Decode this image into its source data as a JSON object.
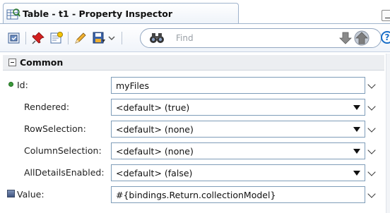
{
  "window": {
    "title": "Table - t1 - Property Inspector"
  },
  "toolbar": {
    "search_placeholder": "Find",
    "icons": [
      "bind-to-data-icon",
      "pin-icon",
      "edit-component-icon",
      "pencil-icon",
      "save-icon",
      "binoculars-icon",
      "search-down-arrow-icon",
      "search-up-arrow-icon",
      "help-icon"
    ],
    "help_label": "?"
  },
  "section": {
    "title": "Common",
    "collapse_symbol": "−"
  },
  "properties": [
    {
      "label": "Id:",
      "value": "myFiles",
      "dropdown": false,
      "required": true
    },
    {
      "label": "Rendered:",
      "value": "<default> (true)",
      "dropdown": true
    },
    {
      "label": "RowSelection:",
      "value": "<default> (none)",
      "dropdown": true
    },
    {
      "label": "ColumnSelection:",
      "value": "<default> (none)",
      "dropdown": true
    },
    {
      "label": "AllDetailsEnabled:",
      "value": "<default> (false)",
      "dropdown": true
    },
    {
      "label": "Value:",
      "value": "#{bindings.Return.collectionModel}",
      "dropdown": false,
      "has_icon": true
    }
  ],
  "colors": {
    "accent": "#1a6fc8",
    "border": "#7f9db9",
    "header_bg": "#eceef1"
  }
}
